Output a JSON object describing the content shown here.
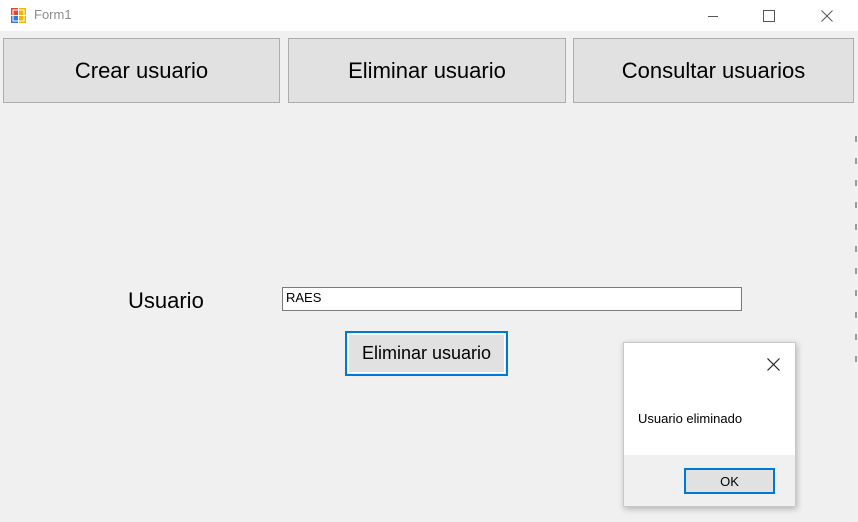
{
  "window": {
    "title": "Form1",
    "icon": "winforms-app-icon",
    "controls": {
      "minimize_icon": "minimize-icon",
      "maximize_icon": "maximize-icon",
      "close_icon": "close-icon"
    }
  },
  "toolbar": {
    "crear_label": "Crear usuario",
    "eliminar_label": "Eliminar usuario",
    "consultar_label": "Consultar usuarios"
  },
  "form": {
    "usuario_label": "Usuario",
    "usuario_value": "RAES",
    "submit_label": "Eliminar usuario"
  },
  "message_box": {
    "text": "Usuario eliminado",
    "ok_label": "OK",
    "close_icon": "close-icon"
  },
  "colors": {
    "accent": "#0078d7",
    "background": "#f0f0f0",
    "button_face": "#e1e1e1"
  }
}
